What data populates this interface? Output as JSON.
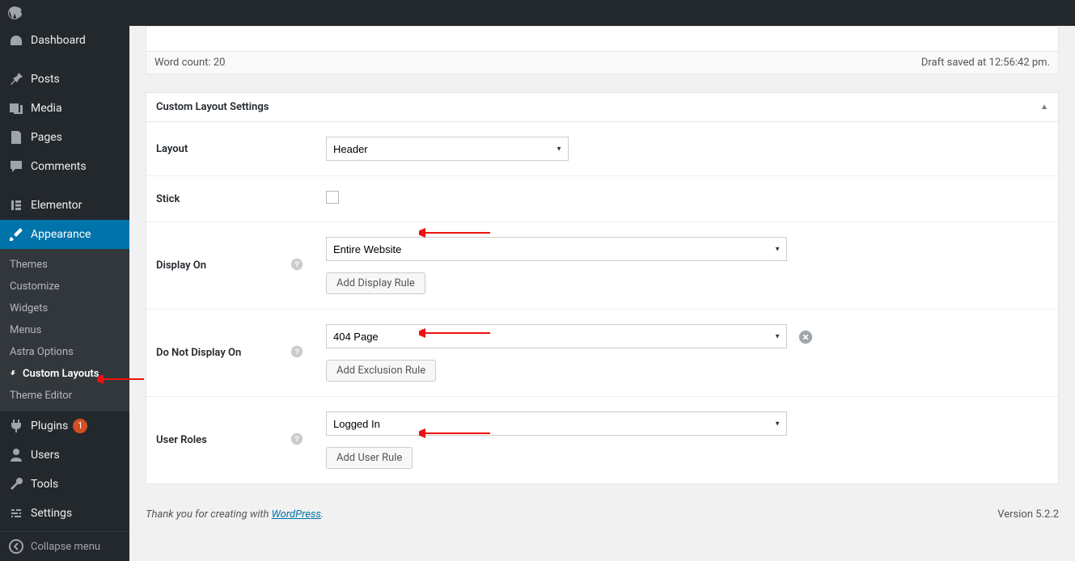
{
  "sidebar": {
    "items": [
      {
        "label": "Dashboard"
      },
      {
        "label": "Posts"
      },
      {
        "label": "Media"
      },
      {
        "label": "Pages"
      },
      {
        "label": "Comments"
      },
      {
        "label": "Elementor"
      },
      {
        "label": "Appearance"
      },
      {
        "label": "Plugins",
        "badge": "1"
      },
      {
        "label": "Users"
      },
      {
        "label": "Tools"
      },
      {
        "label": "Settings"
      }
    ],
    "submenu": [
      "Themes",
      "Customize",
      "Widgets",
      "Menus",
      "Astra Options",
      "Custom Layouts",
      "Theme Editor"
    ],
    "collapse_label": "Collapse menu"
  },
  "editor": {
    "word_count_label": "Word count: 20",
    "draft_status": "Draft saved at 12:56:42 pm."
  },
  "panel": {
    "title": "Custom Layout Settings",
    "layout": {
      "label": "Layout",
      "value": "Header"
    },
    "stick": {
      "label": "Stick"
    },
    "display_on": {
      "label": "Display On",
      "value": "Entire Website",
      "button": "Add Display Rule"
    },
    "not_display": {
      "label": "Do Not Display On",
      "value": "404 Page",
      "button": "Add Exclusion Rule"
    },
    "user_roles": {
      "label": "User Roles",
      "value": "Logged In",
      "button": "Add User Rule"
    }
  },
  "footer": {
    "thanks_pre": "Thank you for creating with ",
    "thanks_link": "WordPress",
    "thanks_post": ".",
    "version": "Version 5.2.2"
  }
}
